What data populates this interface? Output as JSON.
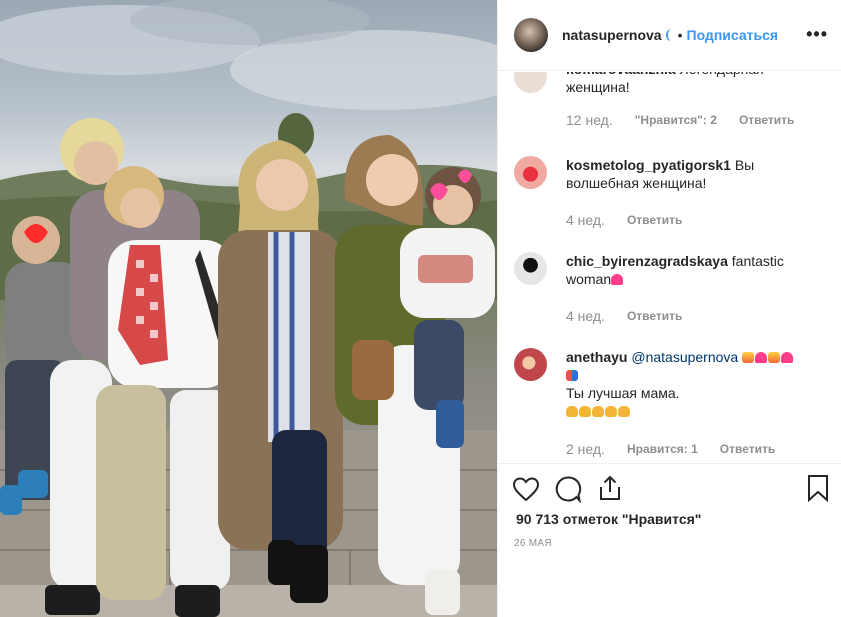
{
  "photo": {
    "alt": ""
  },
  "header": {
    "username": "natasupernova",
    "separator": "•",
    "follow_label": "Подписаться",
    "more_label": "•••"
  },
  "comments": [
    {
      "username": "komarovaanzhla",
      "text": "Легендарная женщина!",
      "age": "12 нед.",
      "likes": "\"Нравится\": 2",
      "reply": "Ответить",
      "avatar_color": "#e9ddd6"
    },
    {
      "username": "kosmetolog_pyatigorsk1",
      "text": "Вы волшебная женщина!",
      "age": "4 нед.",
      "likes": "",
      "reply": "Ответить",
      "avatar_color": "#d9667a"
    },
    {
      "username": "chic_byirenzagradskaya",
      "text": "fantastic woman",
      "age": "4 нед.",
      "likes": "",
      "reply": "Ответить",
      "avatar_color": "#e6e6e6"
    },
    {
      "username": "anethayu",
      "mention": "@natasupernova",
      "text": "Ты лучшая мама.",
      "age": "2 нед.",
      "likes": "Нравится: 1",
      "reply": "Ответить",
      "avatar_color": "#c0464b"
    }
  ],
  "actions": {
    "like_icon": "heart-icon",
    "comment_icon": "comment-icon",
    "share_icon": "share-icon",
    "save_icon": "bookmark-icon",
    "likes_count": "90 713 отметок \"Нравится\"",
    "date": "26 МАЯ"
  }
}
